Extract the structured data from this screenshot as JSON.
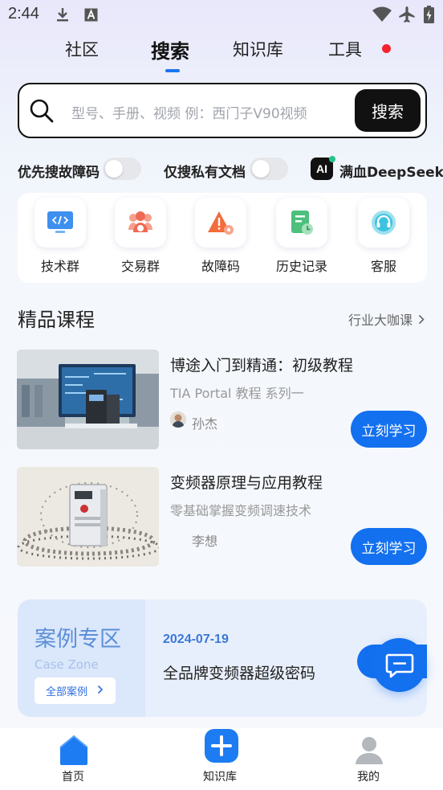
{
  "status_bar": {
    "time": "2:44",
    "left_icons": [
      "download-icon",
      "font-a-icon"
    ],
    "right_icons": [
      "wifi-icon",
      "airplane-icon",
      "battery-charging-icon"
    ]
  },
  "top_tabs": [
    {
      "label": "社区",
      "active": false
    },
    {
      "label": "搜索",
      "active": true
    },
    {
      "label": "知识库",
      "active": false
    },
    {
      "label": "工具",
      "active": false,
      "badge": "red-dot"
    }
  ],
  "search": {
    "placeholder": "型号、手册、视频 例：西门子V90视频",
    "button_label": "搜索"
  },
  "filters": {
    "fault_code_first": {
      "label": "优先搜故障码",
      "on": false
    },
    "private_docs_only": {
      "label": "仅搜私有文档",
      "on": false
    },
    "deepseek": {
      "badge": "AI",
      "label": "满血DeepSeek"
    }
  },
  "quick_entries": [
    {
      "label": "技术群",
      "icon": "code-monitor-icon"
    },
    {
      "label": "交易群",
      "icon": "group-trade-icon"
    },
    {
      "label": "故障码",
      "icon": "warning-triangle-icon"
    },
    {
      "label": "历史记录",
      "icon": "history-doc-icon"
    },
    {
      "label": "客服",
      "icon": "headset-icon"
    }
  ],
  "courses_section": {
    "title": "精品课程",
    "more_label": "行业大咖课"
  },
  "courses": [
    {
      "title": "博途入门到精通：初级教程",
      "subtitle": "TIA Portal 教程 系列一",
      "author": "孙杰",
      "button": "立刻学习"
    },
    {
      "title": "变频器原理与应用教程",
      "subtitle": "零基础掌握变频调速技术",
      "author": "李想",
      "button": "立刻学习"
    }
  ],
  "case_zone": {
    "title": "案例专区",
    "subtitle": "Case Zone",
    "all_label": "全部案例",
    "date": "2024-07-19",
    "text": "全品牌变频器超级密码"
  },
  "bottom_nav": [
    {
      "label": "首页",
      "icon": "home-icon",
      "active": true
    },
    {
      "label": "知识库",
      "icon": "plus-square-icon",
      "active": false
    },
    {
      "label": "我的",
      "icon": "user-icon",
      "active": false
    }
  ],
  "colors": {
    "accent": "#1370ef",
    "search_border": "#111111",
    "red_dot": "#f5222d"
  }
}
